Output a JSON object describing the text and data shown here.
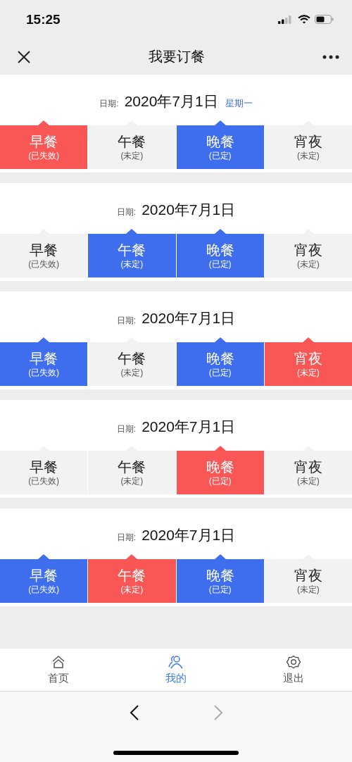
{
  "status_bar": {
    "time": "15:25"
  },
  "nav": {
    "title": "我要订餐"
  },
  "days": [
    {
      "label": "日期:",
      "date": "2020年7月1日",
      "weekday": "星期一",
      "meals": [
        {
          "name": "早餐",
          "note": "(已失效)",
          "color": "#f95656"
        },
        {
          "name": "午餐",
          "note": "(未定)",
          "color": "#f2f2f2"
        },
        {
          "name": "晚餐",
          "note": "(已定)",
          "color": "#3e6ded"
        },
        {
          "name": "宵夜",
          "note": "(未定)",
          "color": "#f2f2f2"
        }
      ]
    },
    {
      "label": "日期:",
      "date": "2020年7月1日",
      "meals": [
        {
          "name": "早餐",
          "note": "(已失效)",
          "color": "#f2f2f2"
        },
        {
          "name": "午餐",
          "note": "(未定)",
          "color": "#3e6ded"
        },
        {
          "name": "晚餐",
          "note": "(已定)",
          "color": "#3e6ded"
        },
        {
          "name": "宵夜",
          "note": "(未定)",
          "color": "#f2f2f2"
        }
      ]
    },
    {
      "label": "日期:",
      "date": "2020年7月1日",
      "meals": [
        {
          "name": "早餐",
          "note": "(已失效)",
          "color": "#3e6ded"
        },
        {
          "name": "午餐",
          "note": "(未定)",
          "color": "#f2f2f2"
        },
        {
          "name": "晚餐",
          "note": "(已定)",
          "color": "#3e6ded"
        },
        {
          "name": "宵夜",
          "note": "(未定)",
          "color": "#f95656"
        }
      ]
    },
    {
      "label": "日期:",
      "date": "2020年7月1日",
      "meals": [
        {
          "name": "早餐",
          "note": "(已失效)",
          "color": "#f2f2f2"
        },
        {
          "name": "午餐",
          "note": "(未定)",
          "color": "#f2f2f2"
        },
        {
          "name": "晚餐",
          "note": "(已定)",
          "color": "#f95656"
        },
        {
          "name": "宵夜",
          "note": "(未定)",
          "color": "#f2f2f2"
        }
      ]
    },
    {
      "label": "日期:",
      "date": "2020年7月1日",
      "meals": [
        {
          "name": "早餐",
          "note": "(已失效)",
          "color": "#3e6ded"
        },
        {
          "name": "午餐",
          "note": "(未定)",
          "color": "#f95656"
        },
        {
          "name": "晚餐",
          "note": "(已定)",
          "color": "#3e6ded"
        },
        {
          "name": "宵夜",
          "note": "(未定)",
          "color": "#f2f2f2"
        }
      ]
    }
  ],
  "tab_bar": [
    {
      "label": "首页",
      "selected": false
    },
    {
      "label": "我的",
      "selected": true
    },
    {
      "label": "退出",
      "selected": false
    }
  ],
  "browser_bar": {
    "back_disabled": false,
    "forward_disabled": true
  }
}
